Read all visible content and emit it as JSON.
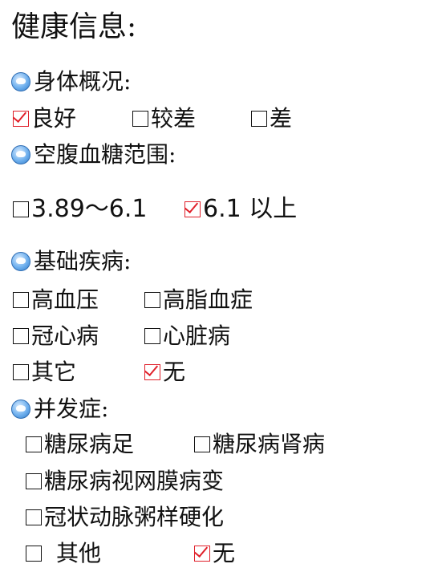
{
  "title": "健康信息:",
  "sections": {
    "body_condition": {
      "label": "身体概况:",
      "options": [
        {
          "label": "良好",
          "checked": true
        },
        {
          "label": "较差",
          "checked": false
        },
        {
          "label": "差",
          "checked": false
        }
      ]
    },
    "blood_sugar": {
      "label": "空腹血糖范围:",
      "options": [
        {
          "label": "3.89～6.1",
          "checked": false
        },
        {
          "label": "6.1 以上",
          "checked": true
        }
      ]
    },
    "chronic_disease": {
      "label": "基础疾病:",
      "options": [
        {
          "label": "高血压",
          "checked": false
        },
        {
          "label": "高脂血症",
          "checked": false
        },
        {
          "label": "冠心病",
          "checked": false
        },
        {
          "label": "心脏病",
          "checked": false
        },
        {
          "label": "其它",
          "checked": false
        },
        {
          "label": "无",
          "checked": true
        }
      ]
    },
    "complications": {
      "label": "并发症:",
      "options": [
        {
          "label": "糖尿病足",
          "checked": false
        },
        {
          "label": "糖尿病肾病",
          "checked": false
        },
        {
          "label": "糖尿病视网膜病变",
          "checked": false
        },
        {
          "label": "冠状动脉粥样硬化",
          "checked": false
        },
        {
          "label": "其他",
          "checked": false
        },
        {
          "label": "无",
          "checked": true
        }
      ]
    }
  },
  "colors": {
    "check_red": "#e0202a",
    "bullet_blue": "#2f79c7"
  }
}
